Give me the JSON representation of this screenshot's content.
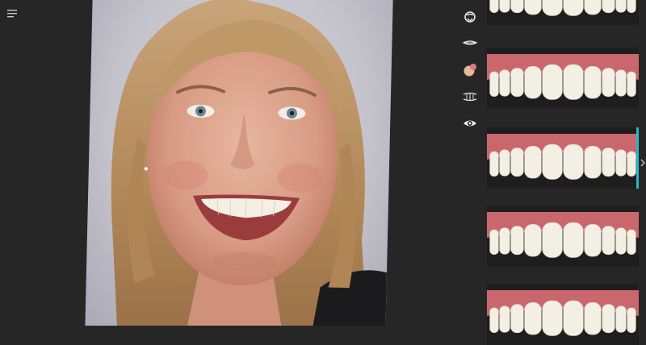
{
  "app": {
    "menu_icon": "hamburger-menu-icon"
  },
  "toolbar": {
    "tools": [
      {
        "icon": "face-rotate-icon"
      },
      {
        "icon": "lip-line-icon"
      },
      {
        "icon": "shade-color-icon"
      },
      {
        "icon": "tooth-outline-icon"
      },
      {
        "icon": "eye-visibility-icon"
      }
    ]
  },
  "library": {
    "selected_index": 2,
    "accent_color": "#27b6cc",
    "thumbnails": [
      {
        "icon": "smile-template-thumbnail"
      },
      {
        "icon": "smile-template-thumbnail"
      },
      {
        "icon": "smile-template-thumbnail"
      },
      {
        "icon": "smile-template-thumbnail"
      },
      {
        "icon": "smile-template-thumbnail"
      }
    ],
    "next_icon": "chevron-right-icon"
  },
  "colors": {
    "background": "#262626",
    "panel": "#1e1e1e",
    "gum": "#c9676d",
    "tooth": "#f3efe4",
    "accent": "#27b6cc"
  }
}
